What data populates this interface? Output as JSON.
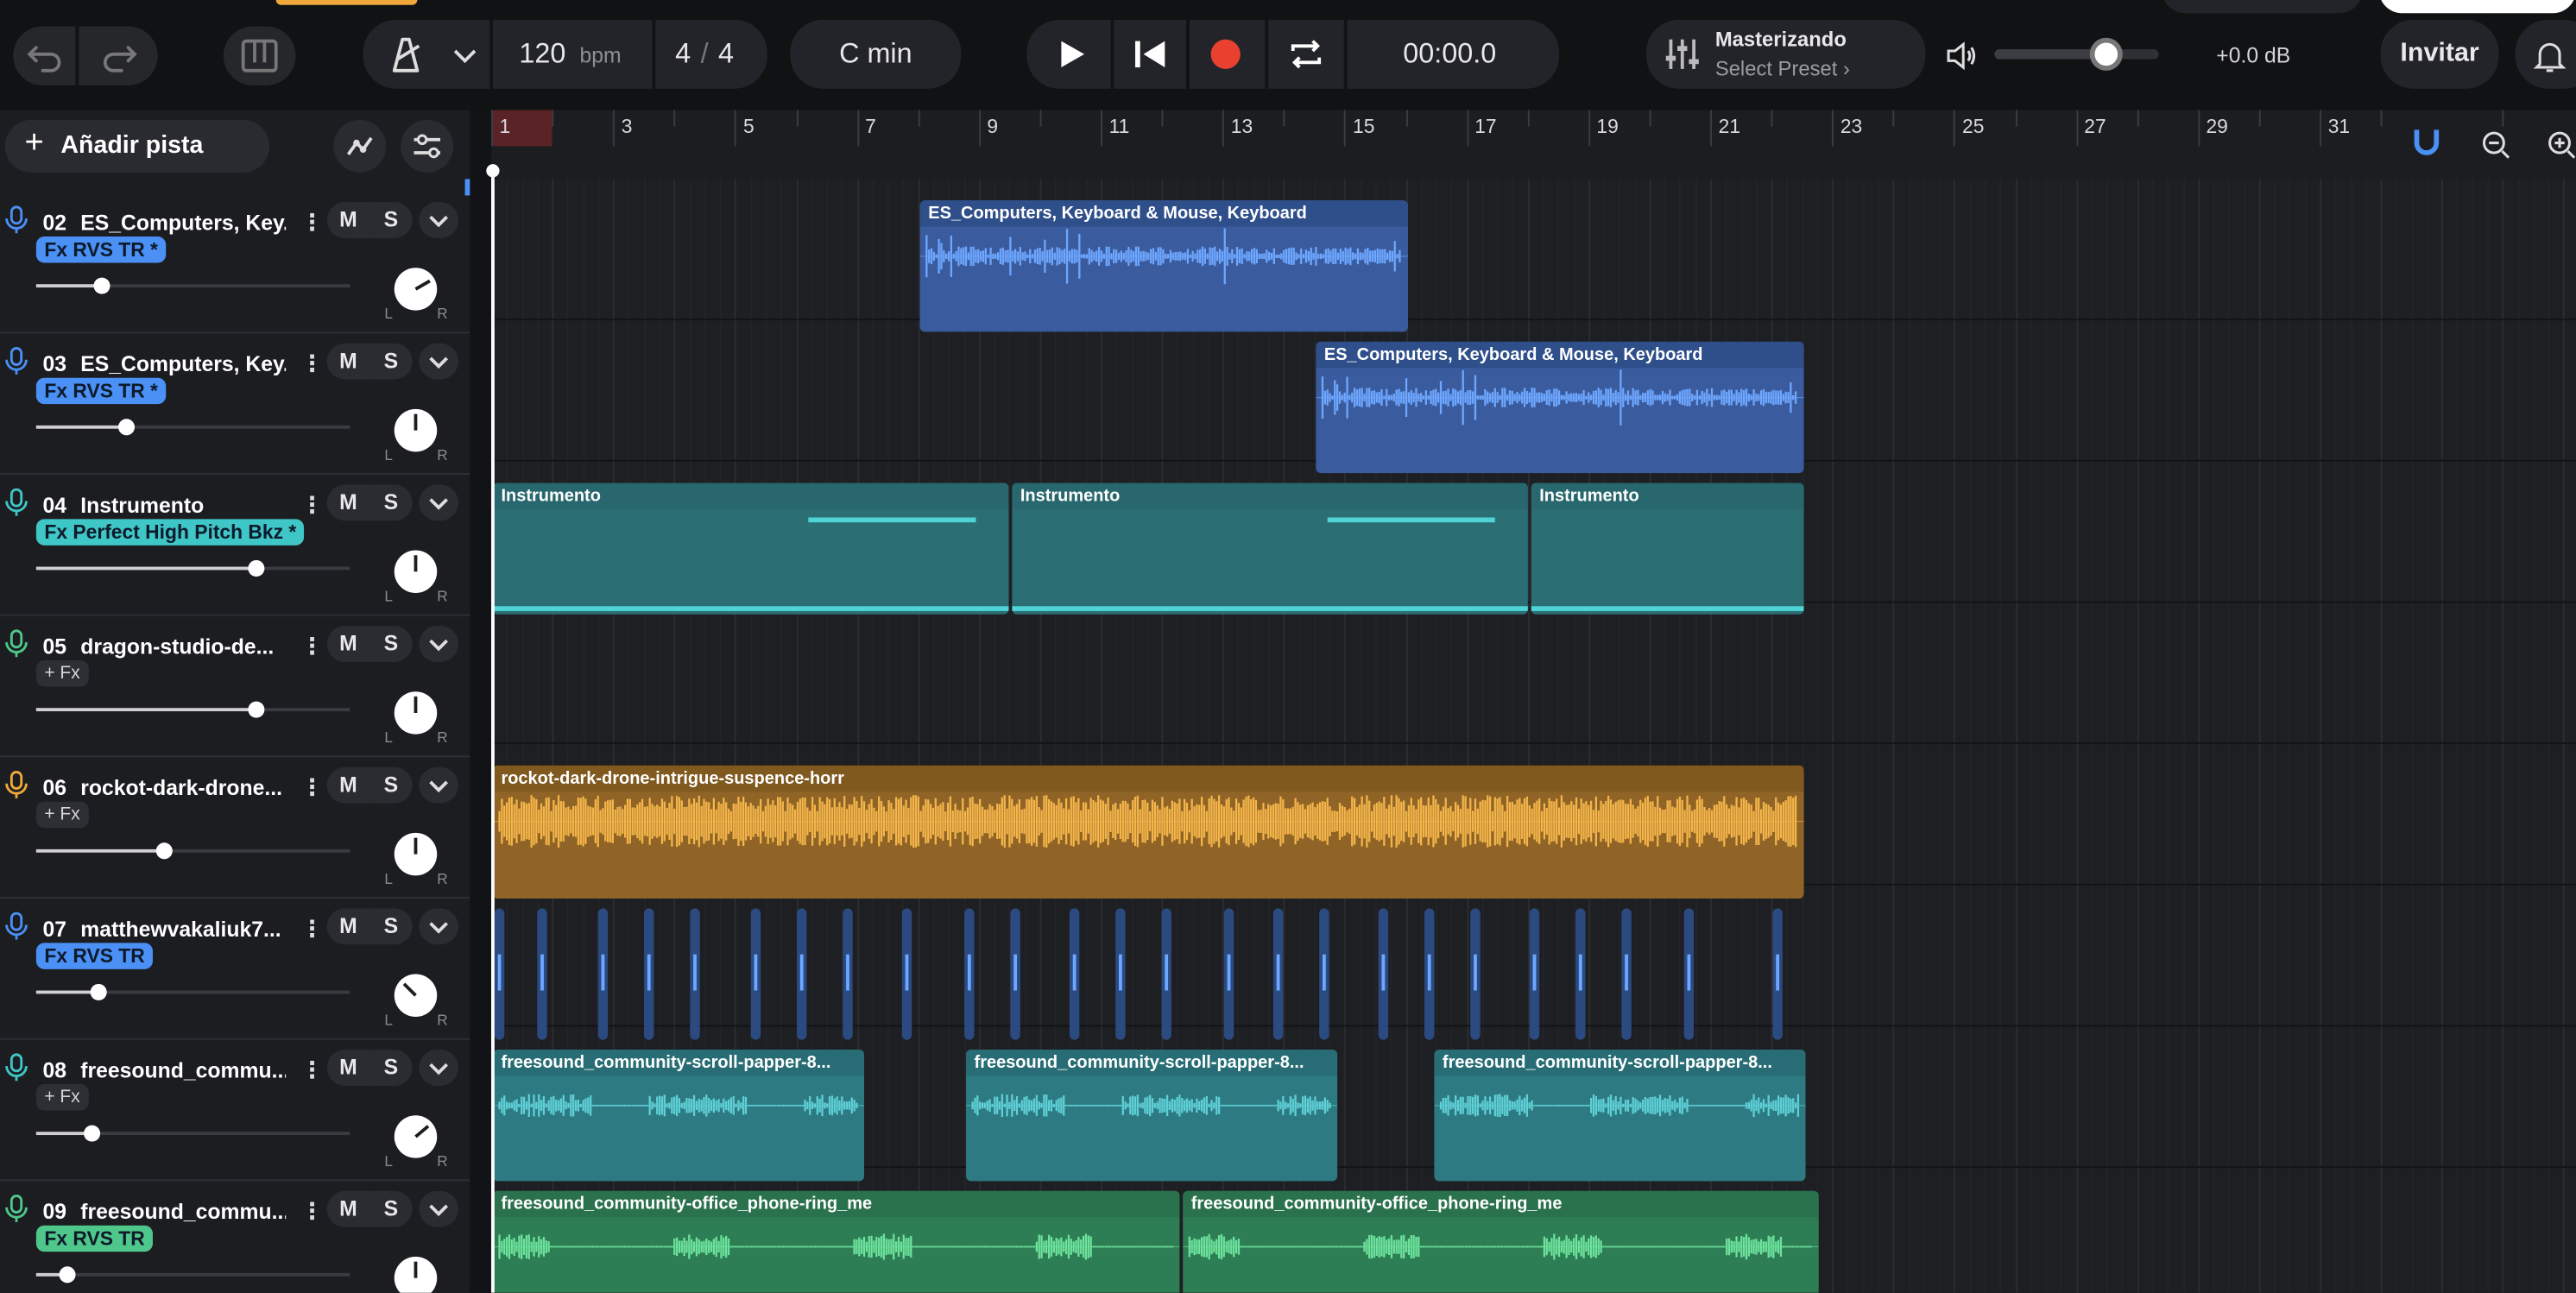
{
  "topbar": {
    "bpm_value": "120",
    "bpm_unit": "bpm",
    "time_sig_num": "4",
    "time_sig_den": "4",
    "key": "C min",
    "time": "00:00.0",
    "master_title": "Masterizando",
    "master_preset": "Select Preset",
    "master_volume": "+0.0 dB",
    "master_volume_level": 0.68,
    "invite": "Invitar"
  },
  "left": {
    "add_track": "Añadir pista",
    "tracks": [
      {
        "num": "02",
        "name": "ES_Computers, Key...",
        "fx": "Fx RVS TR *",
        "fx_color": "#4a90f5",
        "icon_color": "#4a90f5",
        "mute": "M",
        "solo": "S",
        "pan_l": "L",
        "pan_r": "R",
        "volume": 0.21
      },
      {
        "num": "03",
        "name": "ES_Computers, Key...",
        "fx": "Fx RVS TR *",
        "fx_color": "#4a90f5",
        "icon_color": "#4a90f5",
        "mute": "M",
        "solo": "S",
        "pan_l": "L",
        "pan_r": "R",
        "volume": 0.29
      },
      {
        "num": "04",
        "name": "Instrumento",
        "fx": "Fx Perfect High Pitch Bkz *",
        "fx_color": "#3fc6c6",
        "icon_color": "#3fc6c6",
        "mute": "M",
        "solo": "S",
        "pan_l": "L",
        "pan_r": "R",
        "volume": 0.7
      },
      {
        "num": "05",
        "name": "dragon-studio-de...",
        "fx": "+ Fx",
        "fx_color": "",
        "icon_color": "#4fc78a",
        "mute": "M",
        "solo": "S",
        "pan_l": "L",
        "pan_r": "R",
        "volume": 0.7
      },
      {
        "num": "06",
        "name": "rockot-dark-drone...",
        "fx": "+ Fx",
        "fx_color": "",
        "icon_color": "#f0a83a",
        "mute": "M",
        "solo": "S",
        "pan_l": "L",
        "pan_r": "R",
        "volume": 0.41
      },
      {
        "num": "07",
        "name": "matthewvakaliuk7...",
        "fx": "Fx RVS TR",
        "fx_color": "#4a90f5",
        "icon_color": "#4a90f5",
        "mute": "M",
        "solo": "S",
        "pan_l": "L",
        "pan_r": "R",
        "volume": 0.2
      },
      {
        "num": "08",
        "name": "freesound_commu...",
        "fx": "+ Fx",
        "fx_color": "",
        "icon_color": "#3fc6c6",
        "mute": "M",
        "solo": "S",
        "pan_l": "L",
        "pan_r": "R",
        "volume": 0.18
      },
      {
        "num": "09",
        "name": "freesound_commu...",
        "fx": "Fx RVS TR",
        "fx_color": "#4fc78a",
        "icon_color": "#4fc78a",
        "mute": "M",
        "solo": "S",
        "pan_l": "L",
        "pan_r": "R",
        "volume": 0.1
      }
    ]
  },
  "ruler": {
    "labels": [
      "1",
      "3",
      "5",
      "7",
      "9",
      "11",
      "13",
      "15",
      "17",
      "19",
      "21",
      "23",
      "25",
      "27",
      "29",
      "31"
    ]
  },
  "clips": {
    "t02": "ES_Computers, Keyboard & Mouse, Keyboard",
    "t03": "ES_Computers, Keyboard & Mouse, Keyboard",
    "t04a": "Instrumento",
    "t04b": "Instrumento",
    "t04c": "Instrumento",
    "t06": "rockot-dark-drone-intrigue-suspence-horr",
    "t08a": "freesound_community-scroll-papper-8...",
    "t08b": "freesound_community-scroll-papper-8...",
    "t08c": "freesound_community-scroll-papper-8...",
    "t09a": "freesound_community-office_phone-ring_me",
    "t09b": "freesound_community-office_phone-ring_me"
  },
  "colors": {
    "blue": "#4a90f5",
    "teal": "#3fc6c6",
    "orange": "#f0a83a",
    "green": "#4fc78a",
    "record": "#e8412f"
  }
}
